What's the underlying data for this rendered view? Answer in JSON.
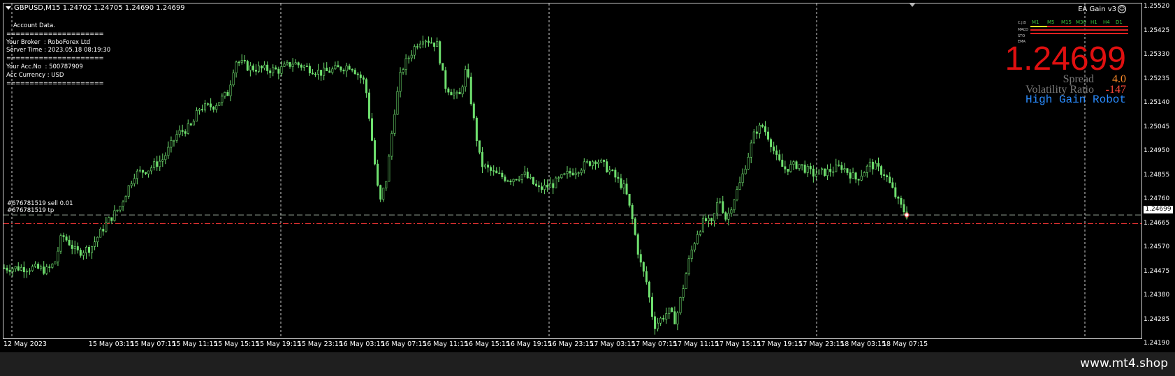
{
  "header": {
    "symbol_line": "GBPUSD,M15  1.24702 1.24705 1.24690 1.24699"
  },
  "account": {
    "title": "Account Data.",
    "separator": "=====================",
    "broker": "Your Broker  : RoboForex Ltd",
    "server_time": "Server Time : 2023.05.18 08:19:30",
    "acc_no": "Your Acc.No  : 500787909",
    "currency": "Acc Currency : USD"
  },
  "ea": {
    "label": "EA Gain  v3",
    "smile": "☺"
  },
  "indicator_panel": {
    "timeframes": [
      "M1",
      "M5",
      "M15",
      "M30",
      "H1",
      "H4",
      "D1"
    ],
    "rows": [
      "C.J.B",
      "MACD",
      "STO",
      "EMA"
    ]
  },
  "quote": {
    "price": "1.24699",
    "spread_label": "Spread",
    "spread_value": "4.0",
    "vol_label": "Volatility Ratio",
    "vol_value": "-147",
    "robot": "High Gain Robot"
  },
  "orders": {
    "sell_label": "#676781519 sell 0.01",
    "tp_label": "#676781519 tp"
  },
  "price_axis": {
    "ticks": [
      "1.25520",
      "1.25425",
      "1.25330",
      "1.25235",
      "1.25140",
      "1.25045",
      "1.24950",
      "1.24855",
      "1.24760",
      "1.24665",
      "1.24570",
      "1.24475",
      "1.24380",
      "1.24285",
      "1.24190"
    ],
    "current": "1.24699"
  },
  "time_axis": {
    "labels": [
      "12 May 2023",
      "15 May 03:15",
      "15 May 07:15",
      "15 May 11:15",
      "15 May 15:15",
      "15 May 19:15",
      "15 May 23:15",
      "16 May 03:15",
      "16 May 07:15",
      "16 May 11:15",
      "16 May 15:15",
      "16 May 19:15",
      "16 May 23:15",
      "17 May 03:15",
      "17 May 07:15",
      "17 May 11:15",
      "17 May 15:15",
      "17 May 19:15",
      "17 May 23:15",
      "18 May 03:15",
      "18 May 07:15"
    ]
  },
  "footer": {
    "site": "www.mt4.shop"
  },
  "colors": {
    "candle": "#6fe06f",
    "sell_line": "#9aa89a",
    "tp_line": "#e03030",
    "price_big": "#e01010",
    "spread_value": "#ff8c2a",
    "robot": "#2a8cff"
  },
  "chart_data": {
    "type": "candlestick",
    "symbol": "GBPUSD",
    "timeframe": "M15",
    "ylim": [
      1.2419,
      1.2552
    ],
    "grid": "vertical dashed",
    "levels": {
      "sell": 1.24699,
      "tp": 1.24665
    },
    "path": [
      [
        0,
        1.2449
      ],
      [
        4,
        1.2449
      ],
      [
        6,
        1.2448
      ],
      [
        7,
        1.2451
      ],
      [
        8,
        1.2462
      ],
      [
        9,
        1.2459
      ],
      [
        10,
        1.2455
      ],
      [
        12,
        1.2457
      ],
      [
        14,
        1.2466
      ],
      [
        16,
        1.2473
      ],
      [
        18,
        1.2486
      ],
      [
        20,
        1.2488
      ],
      [
        22,
        1.2492
      ],
      [
        24,
        1.2502
      ],
      [
        26,
        1.2505
      ],
      [
        27,
        1.2512
      ],
      [
        29,
        1.2513
      ],
      [
        31,
        1.2518
      ],
      [
        32,
        1.2531
      ],
      [
        34,
        1.2528
      ],
      [
        38,
        1.2527
      ],
      [
        40,
        1.253
      ],
      [
        44,
        1.2526
      ],
      [
        48,
        1.2529
      ],
      [
        50,
        1.2522
      ],
      [
        52,
        1.2474
      ],
      [
        53,
        1.2485
      ],
      [
        54,
        1.251
      ],
      [
        55,
        1.2527
      ],
      [
        57,
        1.2537
      ],
      [
        58,
        1.254
      ],
      [
        60,
        1.2537
      ],
      [
        61,
        1.2521
      ],
      [
        63,
        1.2516
      ],
      [
        64,
        1.2528
      ],
      [
        65,
        1.2508
      ],
      [
        66,
        1.249
      ],
      [
        68,
        1.2486
      ],
      [
        70,
        1.2484
      ],
      [
        72,
        1.2486
      ],
      [
        74,
        1.248
      ],
      [
        76,
        1.2482
      ],
      [
        78,
        1.2486
      ],
      [
        80,
        1.2489
      ],
      [
        82,
        1.2492
      ],
      [
        84,
        1.2487
      ],
      [
        86,
        1.248
      ],
      [
        87,
        1.2468
      ],
      [
        88,
        1.2452
      ],
      [
        89,
        1.2443
      ],
      [
        90,
        1.2426
      ],
      [
        92,
        1.2432
      ],
      [
        93,
        1.2428
      ],
      [
        94,
        1.2441
      ],
      [
        95,
        1.2454
      ],
      [
        96,
        1.2463
      ],
      [
        97,
        1.2468
      ],
      [
        98,
        1.2466
      ],
      [
        99,
        1.2477
      ],
      [
        100,
        1.2468
      ],
      [
        101,
        1.2476
      ],
      [
        102,
        1.2483
      ],
      [
        103,
        1.2493
      ],
      [
        104,
        1.2503
      ],
      [
        105,
        1.2505
      ],
      [
        106,
        1.25
      ],
      [
        107,
        1.2492
      ],
      [
        108,
        1.2488
      ],
      [
        110,
        1.249
      ],
      [
        112,
        1.2486
      ],
      [
        114,
        1.2487
      ],
      [
        116,
        1.2489
      ],
      [
        118,
        1.2484
      ],
      [
        120,
        1.249
      ],
      [
        122,
        1.2486
      ],
      [
        123,
        1.248
      ],
      [
        124,
        1.2474
      ],
      [
        125,
        1.247
      ]
    ]
  }
}
